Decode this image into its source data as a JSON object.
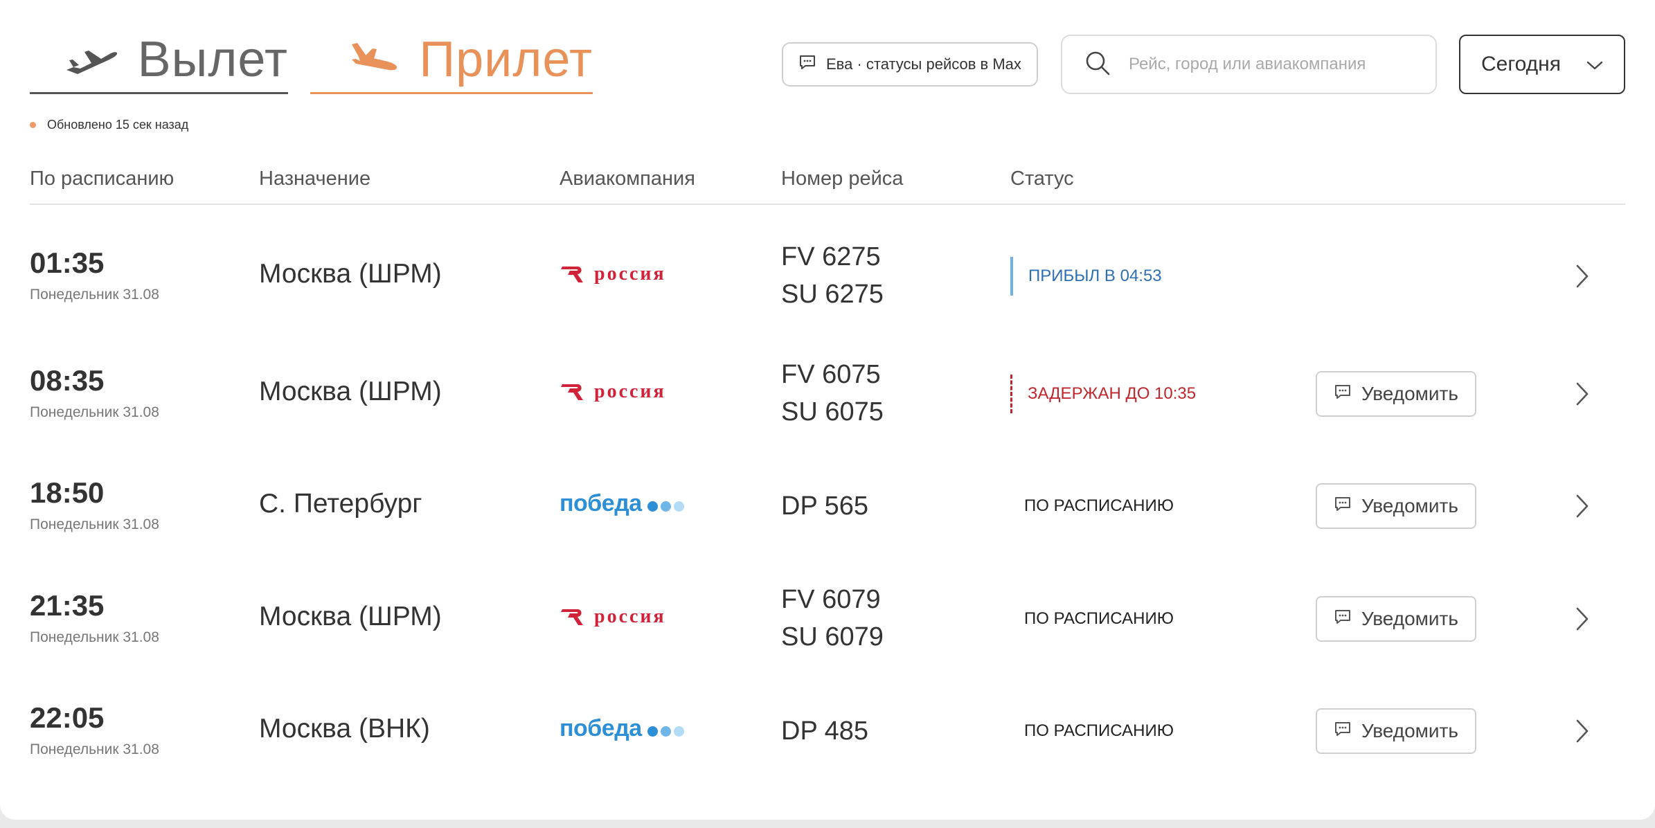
{
  "tabs": {
    "departure": {
      "label": "Вылет",
      "active": false
    },
    "arrival": {
      "label": "Прилет",
      "active": true
    }
  },
  "header": {
    "eva_button": "Ева · статусы рейсов в Max",
    "search_placeholder": "Рейс, город или авиакомпания",
    "date_select": "Сегодня",
    "updated": "Обновлено 15 сек назад"
  },
  "columns": {
    "scheduled": "По расписанию",
    "destination": "Назначение",
    "airline": "Авиакомпания",
    "flight": "Номер рейса",
    "status": "Статус"
  },
  "notify_label": "Уведомить",
  "colors": {
    "accent": "#e8925a",
    "arrived": "#2f6fb3",
    "delayed": "#c0262d",
    "rossiya_red": "#d0233a",
    "pobeda_blue": "#2d8fd6"
  },
  "rows": [
    {
      "time": "01:35",
      "day": "Понедельник 31.08",
      "destination": "Москва (ШРМ)",
      "airline": "россия",
      "flight1": "FV 6275",
      "flight2": "SU 6275",
      "status": "ПРИБЫЛ В 04:53",
      "status_type": "arrived"
    },
    {
      "time": "08:35",
      "day": "Понедельник 31.08",
      "destination": "Москва (ШРМ)",
      "airline": "россия",
      "flight1": "FV 6075",
      "flight2": "SU 6075",
      "status": "ЗАДЕРЖАН ДО 10:35",
      "status_type": "delayed"
    },
    {
      "time": "18:50",
      "day": "Понедельник 31.08",
      "destination": "С. Петербург",
      "airline": "победа",
      "flight1": "DP 565",
      "flight2": "",
      "status": "ПО РАСПИСАНИЮ",
      "status_type": "scheduled"
    },
    {
      "time": "21:35",
      "day": "Понедельник 31.08",
      "destination": "Москва (ШРМ)",
      "airline": "россия",
      "flight1": "FV 6079",
      "flight2": "SU 6079",
      "status": "ПО РАСПИСАНИЮ",
      "status_type": "scheduled"
    },
    {
      "time": "22:05",
      "day": "Понедельник 31.08",
      "destination": "Москва (ВНК)",
      "airline": "победа",
      "flight1": "DP 485",
      "flight2": "",
      "status": "ПО РАСПИСАНИЮ",
      "status_type": "scheduled"
    }
  ]
}
